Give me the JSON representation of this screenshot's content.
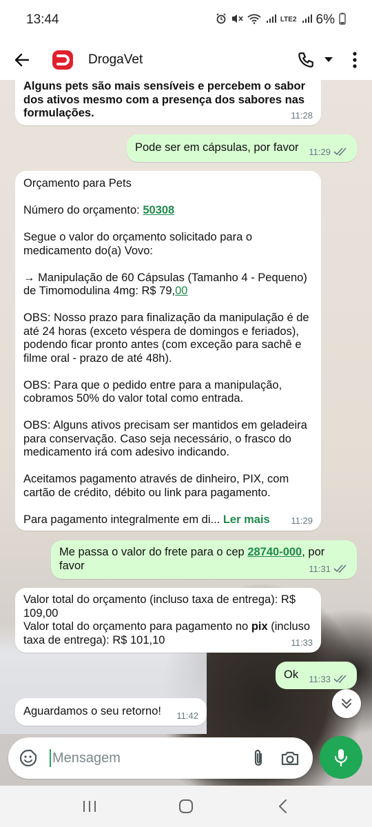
{
  "status": {
    "time": "13:44",
    "battery": "6%",
    "network": "LTE2"
  },
  "header": {
    "contact_name": "DrogaVet"
  },
  "messages": [
    {
      "id": "m1",
      "dir": "in",
      "text": "Alguns pets são mais sensíveis e percebem o sabor dos ativos mesmo com a presença dos sabores nas formulações.",
      "time": "11:28"
    },
    {
      "id": "m2",
      "dir": "out",
      "text": "Pode ser em cápsulas, por favor",
      "time": "11:29"
    },
    {
      "id": "m3",
      "dir": "in",
      "p1": "Orçamento para Pets",
      "p2_label": "Número do orçamento: ",
      "p2_link": "50308",
      "p3": "Segue o valor do orçamento solicitado para o medicamento do(a) Vovo:",
      "p4_text": "→ Manipulação de 60 Cápsulas (Tamanho 4 - Pequeno) de Timomodulina 4mg: R$ 79,",
      "p4_link": "00",
      "p5": "OBS: Nosso prazo para finalização da manipulação é de até 24 horas (exceto véspera de domingos e feriados), podendo ficar pronto antes (com exceção para sachê e filme oral - prazo de até 48h).",
      "p6": "OBS: Para que o pedido entre para a manipulação, cobramos 50% do valor total como entrada.",
      "p7": "OBS: Alguns ativos precisam ser mantidos em geladeira para conservação. Caso seja necessário, o frasco do medicamento irá com adesivo indicando.",
      "p8": "Aceitamos pagamento através de dinheiro, PIX, com cartão de crédito, débito ou link para pagamento.",
      "p9": "Para pagamento integralmente em di...",
      "read_more": "Ler mais",
      "time": "11:29"
    },
    {
      "id": "m4",
      "dir": "out",
      "text_before": "Me passa o valor do frete para o cep ",
      "link": "28740-000",
      "text_after": ", por favor",
      "time": "11:31"
    },
    {
      "id": "m5",
      "dir": "in",
      "line1": "Valor total do orçamento (incluso taxa de entrega): R$ 109,00",
      "line2_before": "Valor total do orçamento para pagamento no ",
      "line2_bold": "pix",
      "line2_after": " (incluso taxa de entrega): R$ 101,10",
      "time": "11:33"
    },
    {
      "id": "m6",
      "dir": "out",
      "text": "Ok",
      "time": "11:33"
    },
    {
      "id": "m7",
      "dir": "in",
      "text": "Aguardamos o seu retorno!",
      "time": "11:42"
    }
  ],
  "composer": {
    "placeholder": "Mensagem"
  },
  "colors": {
    "accent": "#1fa855",
    "outgoing_bubble": "#d9fdd3",
    "incoming_bubble": "#ffffff",
    "brand": "#e0202c"
  }
}
